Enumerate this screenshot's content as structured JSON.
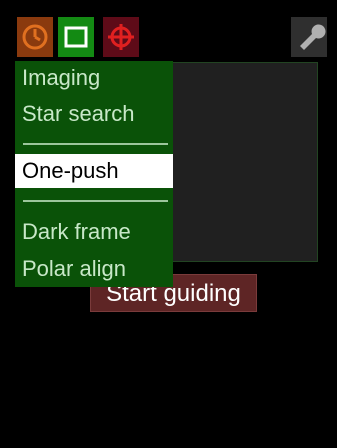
{
  "toolbar": {
    "buttons": [
      {
        "name": "clock-icon",
        "color": "#e07020"
      },
      {
        "name": "frame-icon",
        "color": "#ffffff"
      },
      {
        "name": "crosshair-icon",
        "color": "#e02020"
      },
      {
        "name": "wrench-icon",
        "color": "#b0b0b0"
      }
    ]
  },
  "menu": {
    "items": [
      "Imaging",
      "Star search",
      "One-push",
      "Dark frame",
      "Polar align"
    ],
    "selected": "One-push"
  },
  "main": {
    "start_button_label": "Start guiding"
  }
}
